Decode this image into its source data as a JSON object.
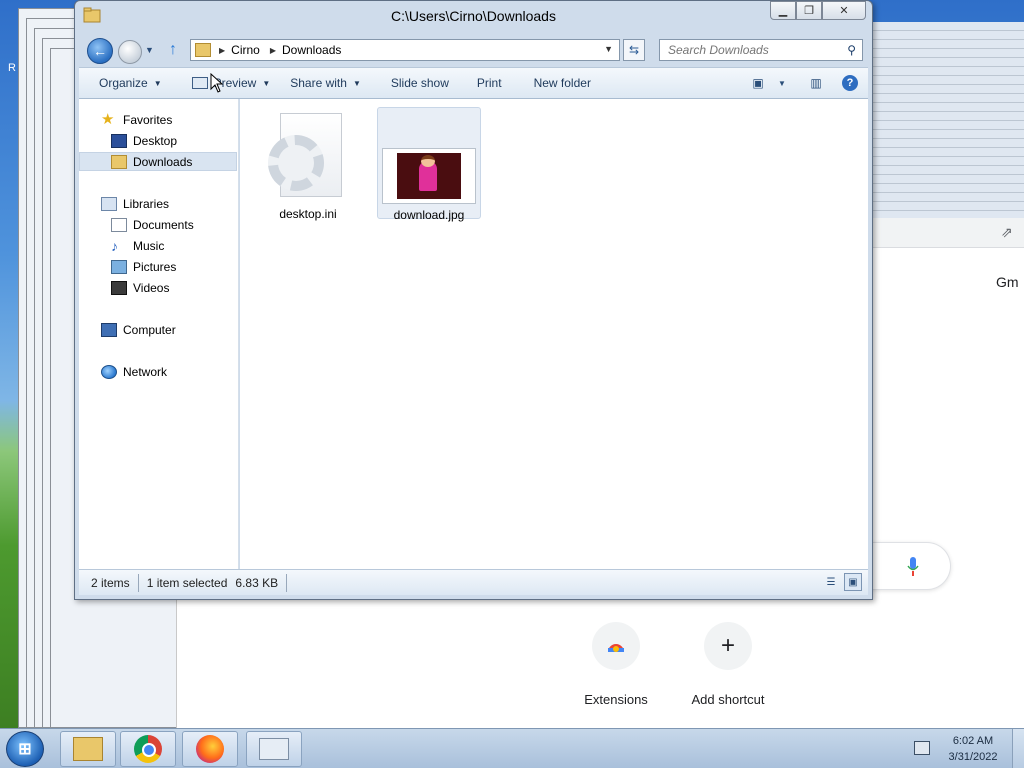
{
  "desktop": {
    "edge_label": "R"
  },
  "browser": {
    "gmail_link": "Gm",
    "shortcuts": [
      {
        "label": "Extensions",
        "icon": "chrome-web-store-icon"
      },
      {
        "label": "Add shortcut",
        "icon": "plus-icon",
        "glyph": "+"
      }
    ]
  },
  "explorer": {
    "title": "C:\\Users\\Cirno\\Downloads",
    "breadcrumb": [
      "Cirno",
      "Downloads"
    ],
    "search_placeholder": "Search Downloads",
    "toolbar": {
      "organize": "Organize",
      "preview": "Preview",
      "share_with": "Share with",
      "slide_show": "Slide show",
      "print": "Print",
      "new_folder": "New folder"
    },
    "nav": {
      "favorites": "Favorites",
      "desktop": "Desktop",
      "downloads": "Downloads",
      "libraries": "Libraries",
      "documents": "Documents",
      "music": "Music",
      "pictures": "Pictures",
      "videos": "Videos",
      "computer": "Computer",
      "network": "Network"
    },
    "files": [
      {
        "name": "desktop.ini",
        "icon": "settings-file-icon",
        "selected": false
      },
      {
        "name": "download.jpg",
        "icon": "image-thumbnail",
        "selected": true
      }
    ],
    "status": {
      "items": "2 items",
      "selected": "1 item selected",
      "size": "6.83 KB"
    }
  },
  "taskbar": {
    "apps": [
      "windows-explorer-icon",
      "google-chrome-icon",
      "firefox-icon",
      "window-preview-icon"
    ],
    "time": "6:02 AM",
    "date": "3/31/2022"
  },
  "colors": {
    "accent": "#2e6dc0",
    "selection": "#d9e4f1",
    "toolbar_text": "#1e395b"
  }
}
